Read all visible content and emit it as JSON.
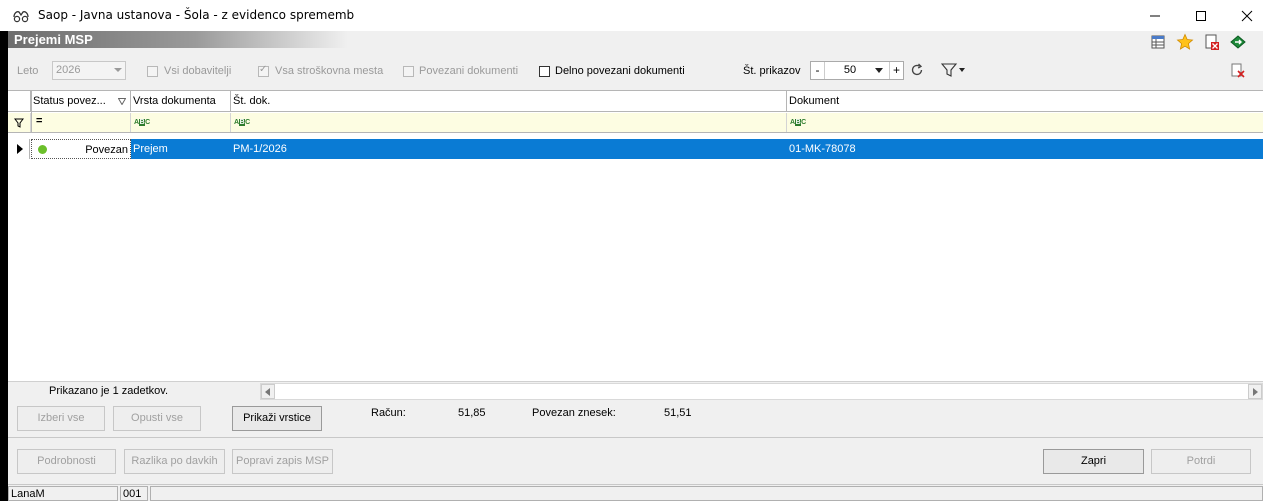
{
  "window": {
    "title": "Saop  - Javna ustanova - Šola - z evidenco sprememb",
    "minimize": "—",
    "maximize": "☐",
    "close": "✕"
  },
  "panel": {
    "title": "Prejemi MSP"
  },
  "toolbar": {
    "year_label": "Leto",
    "year_value": "2026",
    "all_suppliers": "Vsi dobavitelji",
    "all_cost_centers": "Vsa stroškovna mesta",
    "linked_documents": "Povezani dokumenti",
    "partially_linked": "Delno povezani dokumenti",
    "display_count_label": "Št. prikazov",
    "display_count_value": "50",
    "minus": "-",
    "plus": "+"
  },
  "grid": {
    "columns": [
      "Status povez...",
      "Vrsta dokumenta",
      "Št. dok.",
      "Dokument"
    ],
    "filter_equals": "=",
    "rows": [
      {
        "status": "Povezan",
        "type": "Prejem",
        "doc_no": "PM-1/2026",
        "document": "01-MK-78078"
      }
    ],
    "footer_text": "Prikazano je 1 zadetkov."
  },
  "actions": {
    "select_all": "Izberi vse",
    "deselect_all": "Opusti vse",
    "show_lines": "Prikaži vrstice",
    "invoice_label": "Račun:",
    "invoice_value": "51,85",
    "linked_amount_label": "Povezan znesek:",
    "linked_amount_value": "51,51"
  },
  "bottom": {
    "details": "Podrobnosti",
    "tax_difference": "Razlika po davkih",
    "fix_msp": "Popravi zapis MSP",
    "close": "Zapri",
    "confirm": "Potrdi"
  },
  "statusbar": {
    "user": "LanaM",
    "code": "001"
  },
  "colors": {
    "selection": "#0a7bd4",
    "status_green": "#6bbf2a",
    "filter_bg": "#fdfde2"
  }
}
